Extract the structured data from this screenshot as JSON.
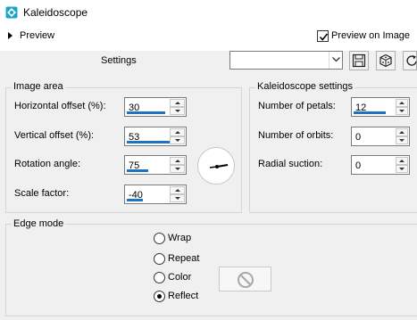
{
  "window": {
    "title": "Kaleidoscope",
    "icon": "kaleidoscope-app-icon"
  },
  "preview": {
    "toggle_label": "Preview",
    "preview_on_image_label": "Preview on Image",
    "preview_on_image_checked": true
  },
  "settings": {
    "label": "Settings",
    "preset_value": "",
    "icons": [
      "save-icon",
      "dice-icon",
      "reset-icon"
    ]
  },
  "image_area": {
    "title": "Image area",
    "horizontal_offset": {
      "label": "Horizontal offset (%):",
      "value": "30"
    },
    "vertical_offset": {
      "label": "Vertical offset (%):",
      "value": "53"
    },
    "rotation_angle": {
      "label": "Rotation angle:",
      "value": "75"
    },
    "scale_factor": {
      "label": "Scale factor:",
      "value": "-40"
    }
  },
  "kaleidoscope_settings": {
    "title": "Kaleidoscope settings",
    "petals": {
      "label": "Number of petals:",
      "value": "12"
    },
    "orbits": {
      "label": "Number of orbits:",
      "value": "0"
    },
    "radial_suction": {
      "label": "Radial suction:",
      "value": "0"
    }
  },
  "edge_mode": {
    "title": "Edge mode",
    "options": [
      "Wrap",
      "Repeat",
      "Color",
      "Reflect"
    ],
    "selected": "Reflect",
    "color_swatch_icon": "no-color-icon"
  },
  "colors": {
    "accent": "#1e73be",
    "app_icon": "#1aa5c8"
  }
}
